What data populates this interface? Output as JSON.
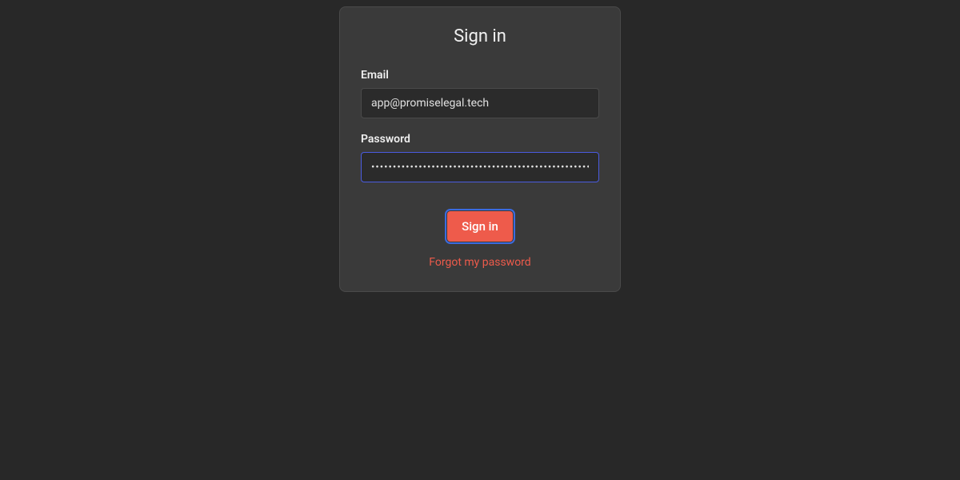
{
  "card": {
    "title": "Sign in",
    "email": {
      "label": "Email",
      "value": "app@promiselegal.tech"
    },
    "password": {
      "label": "Password",
      "value": "•••••••••••••••••••••••••••••••••••••••••••••••••••••••••"
    },
    "submit_label": "Sign in",
    "forgot_label": "Forgot my password"
  }
}
